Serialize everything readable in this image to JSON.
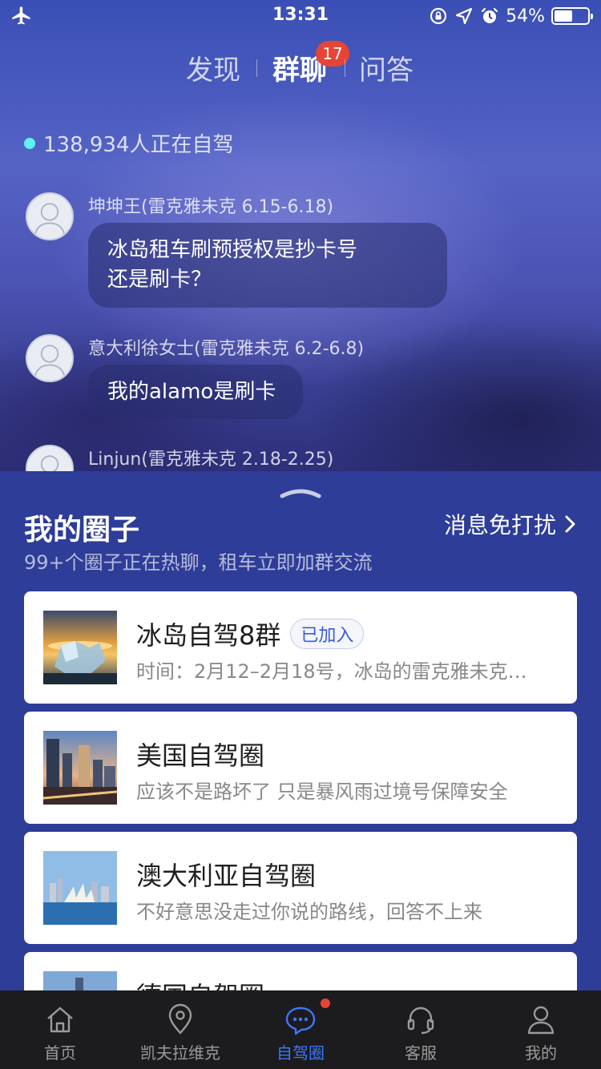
{
  "status_bar": {
    "time": "13:31",
    "battery": "54%",
    "battery_level": 0.54,
    "icons": [
      "airplane-icon",
      "orientation-lock-icon",
      "location-icon",
      "alarm-icon",
      "battery-icon"
    ]
  },
  "tabs": [
    {
      "label": "发现",
      "active": false
    },
    {
      "label": "群聊",
      "active": true,
      "badge": "17"
    },
    {
      "label": "问答",
      "active": false
    }
  ],
  "online": {
    "text": "138,934人正在自驾",
    "dot_color": "#5ef2f2"
  },
  "messages": [
    {
      "name": "坤坤王(雷克雅未克 6.15-6.18)",
      "lines": [
        "冰岛租车刷预授权是抄卡号",
        "还是刷卡？"
      ]
    },
    {
      "name": "意大利徐女士(雷克雅未克 6.2-6.8)",
      "lines": [
        "我的alamo是刷卡"
      ]
    },
    {
      "name": "Linjun(雷克雅未克 2.18-2.25)",
      "lines": []
    }
  ],
  "sheet": {
    "title": "我的圈子",
    "dnd_label": "消息免打扰",
    "subtitle": "99+个圈子正在热聊，租车立即加群交流"
  },
  "groups": [
    {
      "title": "冰岛自驾8群",
      "joined_label": "已加入",
      "desc": "时间：2月12–2月18号，冰岛的雷克雅未克…"
    },
    {
      "title": "美国自驾圈",
      "desc": "应该不是路坏了 只是暴风雨过境号保障安全"
    },
    {
      "title": "澳大利亚自驾圈",
      "desc": "不好意思没走过你说的路线，回答不上来"
    },
    {
      "title": "德国自驾圈",
      "desc": ""
    }
  ],
  "tabbar": [
    {
      "label": "首页",
      "icon": "home-icon",
      "active": false
    },
    {
      "label": "凯夫拉维克",
      "icon": "location-pin-icon",
      "active": false
    },
    {
      "label": "自驾圈",
      "icon": "chat-bubble-icon",
      "active": true,
      "dot": true
    },
    {
      "label": "客服",
      "icon": "headset-icon",
      "active": false
    },
    {
      "label": "我的",
      "icon": "person-icon",
      "active": false
    }
  ],
  "colors": {
    "accent": "#3d76ff",
    "badge_red": "#e64435",
    "sheet_bg": "#2e3d98",
    "tabbar_bg": "#1c1c1e"
  }
}
